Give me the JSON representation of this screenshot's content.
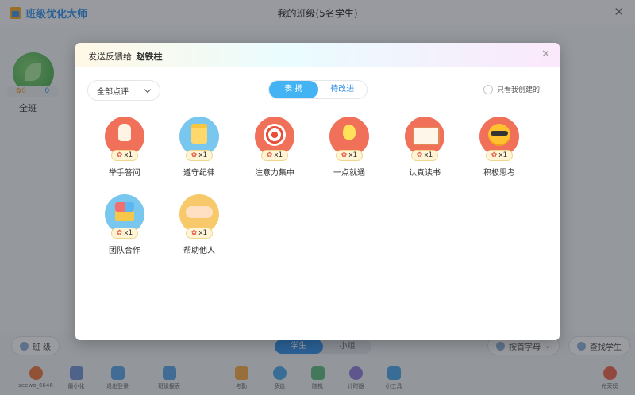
{
  "app": {
    "brand": "班级优化大师",
    "window_title": "我的班级(5名学生)",
    "class_card": {
      "name": "全班",
      "score_plus": "0",
      "score_minus": "0"
    },
    "left_button": "班 级",
    "view_tabs": [
      "学生",
      "小组"
    ],
    "sort_button": "按首字母",
    "find_button": "查找学生",
    "toolbar": [
      {
        "label": "seewo_6646",
        "icon": "user-logo-icon",
        "color": "#e8713a"
      },
      {
        "label": "最小化",
        "icon": "minimize-icon",
        "color": "#6f8fd0"
      },
      {
        "label": "退出登录",
        "icon": "logout-icon",
        "color": "#5aa0e6"
      },
      {
        "label": "班级报表",
        "icon": "report-icon",
        "color": "#5aa0e6"
      },
      {
        "label": "考勤",
        "icon": "attendance-icon",
        "color": "#f0a640"
      },
      {
        "label": "多选",
        "icon": "multi-select-icon",
        "color": "#4aa3e8"
      },
      {
        "label": "随机",
        "icon": "random-icon",
        "color": "#5ab87a"
      },
      {
        "label": "计时器",
        "icon": "timer-icon",
        "color": "#8c7ad6"
      },
      {
        "label": "小工具",
        "icon": "tools-icon",
        "color": "#4aa3e8"
      },
      {
        "label": "光荣榜",
        "icon": "honor-icon",
        "color": "#e8624a"
      }
    ]
  },
  "modal": {
    "title_prefix": "发送反馈给",
    "student_name": "赵铁柱",
    "filter_label": "全部点评",
    "tabs": [
      "表 扬",
      "待改进"
    ],
    "only_mine_label": "只看我创建的",
    "items": [
      {
        "label": "举手答问",
        "count": "x1",
        "icon": "raise-hand-icon",
        "color": "#f0705a"
      },
      {
        "label": "遵守纪律",
        "icon": "discipline-icon",
        "count": "x1",
        "color": "#79c6ef"
      },
      {
        "label": "注意力集中",
        "icon": "target-icon",
        "count": "x1",
        "color": "#f0705a"
      },
      {
        "label": "一点就通",
        "icon": "lightbulb-icon",
        "count": "x1",
        "color": "#f0705a"
      },
      {
        "label": "认真读书",
        "icon": "book-icon",
        "count": "x1",
        "color": "#f0705a"
      },
      {
        "label": "积极思考",
        "icon": "sunglasses-sun-icon",
        "count": "x1",
        "color": "#f0705a"
      },
      {
        "label": "团队合作",
        "icon": "puzzle-icon",
        "count": "x1",
        "color": "#79c6ef"
      },
      {
        "label": "帮助他人",
        "icon": "handshake-icon",
        "count": "x1",
        "color": "#f7c96a"
      }
    ]
  }
}
